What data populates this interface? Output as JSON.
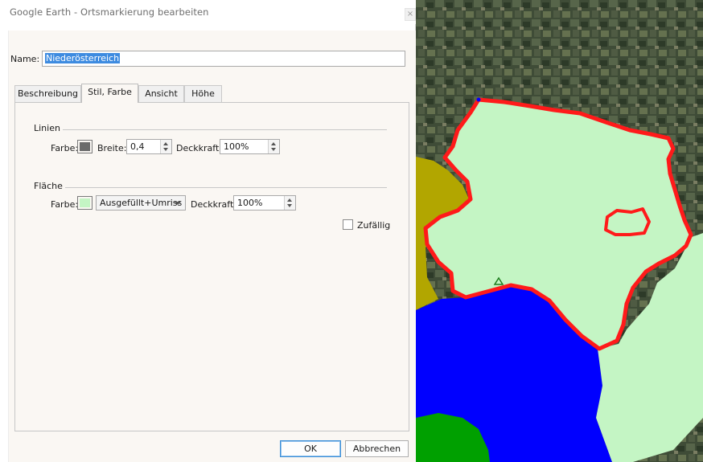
{
  "window": {
    "title": "Google Earth - Ortsmarkierung bearbeiten",
    "close_glyph": "×"
  },
  "name_field": {
    "label": "Name:",
    "value": "Niederösterreich"
  },
  "tabs": [
    {
      "label": "Beschreibung",
      "active": false
    },
    {
      "label": "Stil, Farbe",
      "active": true
    },
    {
      "label": "Ansicht",
      "active": false
    },
    {
      "label": "Höhe",
      "active": false
    }
  ],
  "lines_group": {
    "title": "Linien",
    "color_label": "Farbe:",
    "color": "#6b6b6b",
    "width_label": "Breite:",
    "width_value": "0,4",
    "opacity_label": "Deckkraft:",
    "opacity_value": "100%"
  },
  "area_group": {
    "title": "Fläche",
    "color_label": "Farbe:",
    "color": "#c4f5c4",
    "fill_mode": "Ausgefüllt+Umriss",
    "opacity_label": "Deckkraft:",
    "opacity_value": "100%",
    "random_label": "Zufällig",
    "random_checked": false
  },
  "buttons": {
    "ok": "OK",
    "cancel": "Abbrechen"
  },
  "map": {
    "colors": {
      "terrain": "#3d4a35",
      "region_fill": "#c4f5c4",
      "region_outline": "#ff1a1a",
      "neighbor_west": "#b2a600",
      "neighbor_south": "#0000ff",
      "neighbor_southwest": "#00a000"
    },
    "marker_icon": "triangle-outline-icon"
  }
}
